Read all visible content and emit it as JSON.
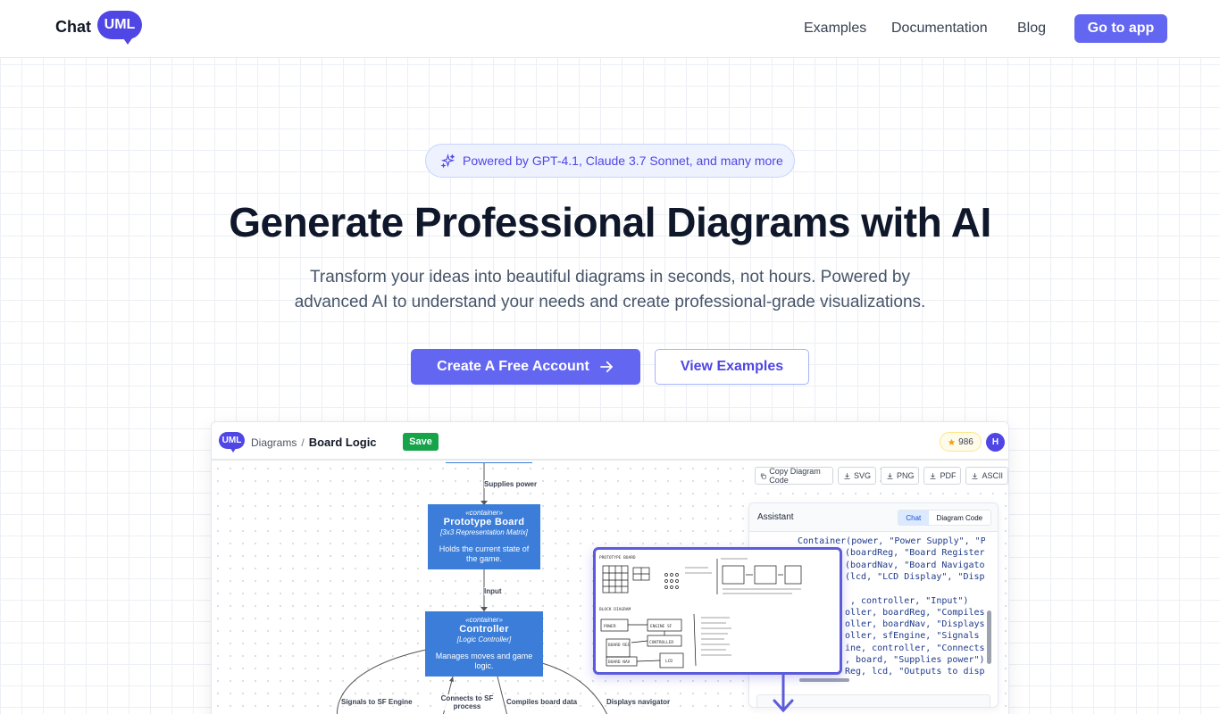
{
  "header": {
    "logo_word": "Chat",
    "logo_badge": "UML",
    "nav": [
      "Examples",
      "Documentation",
      "Blog"
    ],
    "cta": "Go to app"
  },
  "hero": {
    "badge": "Powered by GPT-4.1, Claude 3.7 Sonnet, and many more",
    "title": "Generate Professional Diagrams with AI",
    "subtitle_line1": "Transform your ideas into beautiful diagrams in seconds, not hours. Powered by",
    "subtitle_line2": "advanced AI to understand your needs and create professional-grade visualizations.",
    "primary_button": "Create A Free Account",
    "secondary_button": "View Examples"
  },
  "preview": {
    "logo_badge": "UML",
    "breadcrumb_root": "Diagrams",
    "breadcrumb_sep": "/",
    "breadcrumb_current": "Board Logic",
    "save_label": "Save",
    "credits": "986",
    "avatar_initial": "H",
    "tools": [
      "Copy Diagram Code",
      "SVG",
      "PNG",
      "PDF",
      "ASCII"
    ],
    "diagram": {
      "edge_top": "Supplies power",
      "edge_input": "Input",
      "node1": {
        "stereotype": "«container»",
        "name": "Prototype Board",
        "tech": "[3x3 Representation Matrix]",
        "desc": "Holds the current state of the game."
      },
      "node2": {
        "stereotype": "«container»",
        "name": "Controller",
        "tech": "[Logic Controller]",
        "desc": "Manages moves and game logic."
      },
      "edges_bottom": [
        "Signals to SF Engine",
        "Connects to SF process",
        "Compiles board data",
        "Displays navigator"
      ]
    },
    "sketch": {
      "title1": "PROTOTYPE BOARD",
      "title2": "BLOCK DIAGRAM",
      "blocks": [
        "POWER",
        "ENGINE SF",
        "CONTROLLER",
        "BOARD REG",
        "BOARD NAV",
        "LCD"
      ]
    },
    "assistant": {
      "title": "Assistant",
      "tab_chat": "Chat",
      "tab_code": "Diagram Code",
      "code_lines": [
        "Container(power, \"Power Supply\", \"P",
        "(boardReg, \"Board Register",
        "(boardNav, \"Board Navigato",
        "(lcd, \"LCD Display\", \"Disp",
        "",
        ", controller, \"Input\")",
        "oller, boardReg, \"Compiles",
        "oller, boardNav, \"Displays",
        "oller, sfEngine, \"Signals",
        "ine, controller, \"Connects",
        ", board, \"Supplies power\")",
        "Reg, lcd, \"Outputs to disp"
      ]
    }
  },
  "colors": {
    "brand": "#6366f1",
    "brand_dark": "#4f46e5",
    "node": "#3b7dd8",
    "save": "#16a34a"
  }
}
